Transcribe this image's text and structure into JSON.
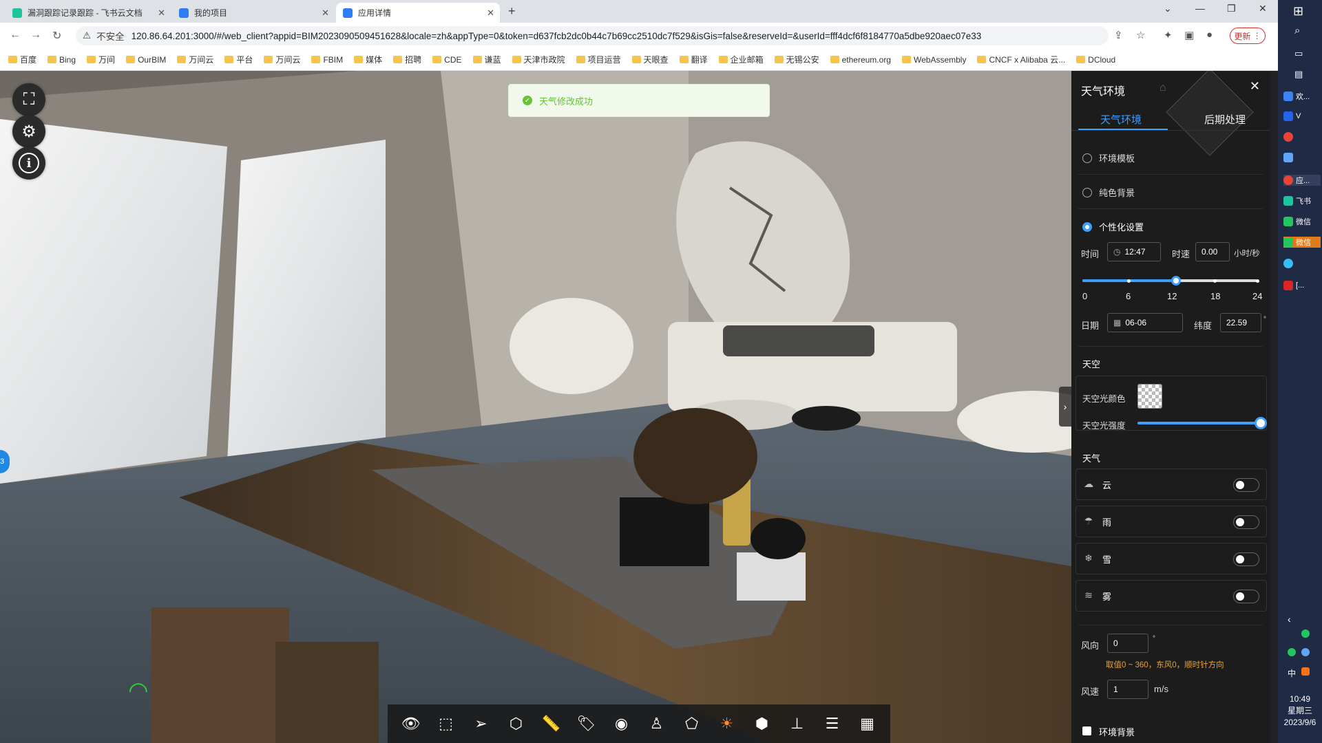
{
  "browser": {
    "tabs": [
      {
        "label": "漏洞跟踪记录跟踪 - 飞书云文档",
        "color": "#1ec49c"
      },
      {
        "label": "我的项目",
        "color": "#2f7df6"
      },
      {
        "label": "应用详情",
        "color": "#2f7df6"
      }
    ],
    "security_label": "不安全",
    "url": "120.86.64.201:3000/#/web_client?appid=BIM2023090509451628&locale=zh&appType=0&token=d637fcb2dc0b44c7b69cc2510dc7f529&isGis=false&reserveId=&userId=fff4dcf6f8184770a5dbe920aec07e33",
    "update_label": "更新",
    "bookmarks": [
      "百度",
      "Bing",
      "万间",
      "OurBIM",
      "万间云",
      "平台",
      "万间云",
      "FBIM",
      "媒体",
      "招聘",
      "CDE",
      "谦蓝",
      "天津市政院",
      "项目运营",
      "天眼查",
      "翻译",
      "企业邮箱",
      "无锡公安",
      "ethereum.org",
      "WebAssembly",
      "CNCF x Alibaba 云...",
      "DCloud"
    ]
  },
  "toast": {
    "message": "天气修改成功"
  },
  "panel": {
    "title": "天气环境",
    "tabs": [
      "天气环境",
      "后期处理"
    ],
    "options": [
      "环境模板",
      "纯色背景",
      "个性化设置"
    ],
    "time": {
      "label": "时间",
      "value": "12:47",
      "speed_label": "时速",
      "speed_value": "0.00",
      "speed_unit": "小时/秒",
      "slider_value": 12.78,
      "ticks": [
        "0",
        "6",
        "12",
        "18",
        "24"
      ]
    },
    "date": {
      "label": "日期",
      "value": "06-06",
      "lat_label": "纬度",
      "lat_value": "22.59",
      "lat_unit": "°"
    },
    "sky": {
      "section": "天空",
      "color_label": "天空光颜色",
      "intensity_label": "天空光强度",
      "intensity_value": 1.0
    },
    "weather": {
      "section": "天气",
      "items": [
        {
          "label": "云",
          "icon": "cloud-icon",
          "enabled": false
        },
        {
          "label": "雨",
          "icon": "rain-icon",
          "enabled": false
        },
        {
          "label": "雪",
          "icon": "snow-icon",
          "enabled": false
        },
        {
          "label": "雾",
          "icon": "fog-icon",
          "enabled": false
        }
      ]
    },
    "wind": {
      "dir_label": "风向",
      "dir_value": "0",
      "dir_unit": "°",
      "hint": "取值0 ~ 360，东风0，顺时针方向",
      "speed_label": "风速",
      "speed_value": "1",
      "speed_unit": "m/s"
    },
    "env_bg_label": "环境背景"
  },
  "taskbar": {
    "items": [
      "欢...",
      "V",
      "",
      "",
      "应...",
      "飞书",
      "微信",
      "微信",
      "",
      "[..."
    ],
    "ime": "中",
    "time": "10:49",
    "weekday": "星期三",
    "date": "2023/9/6"
  },
  "toolbar_icons": [
    "eye-icon",
    "frame-select-icon",
    "send-icon",
    "cube-icon",
    "measure-icon",
    "tag-icon",
    "view-focus-icon",
    "person-icon",
    "section-icon",
    "weather-icon",
    "box-icon",
    "tree-icon",
    "properties-icon",
    "settings-grid-icon"
  ]
}
